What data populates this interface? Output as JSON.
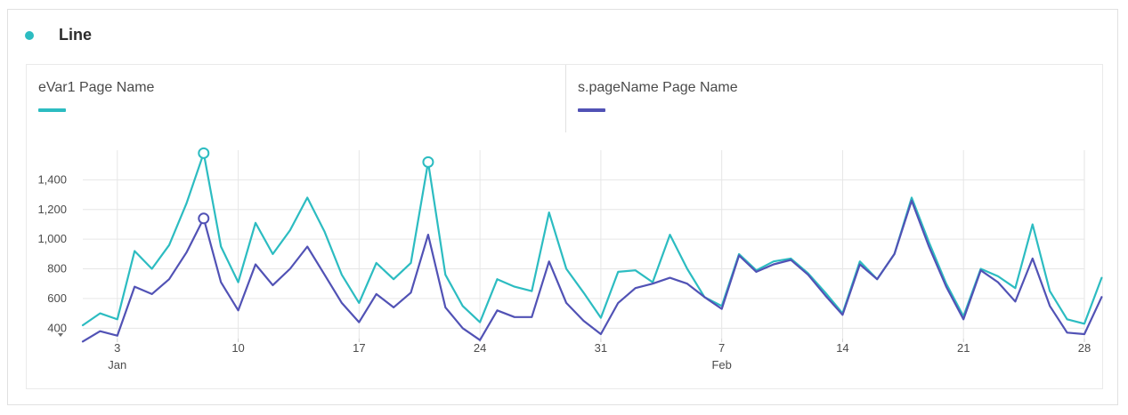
{
  "header": {
    "title": "Line",
    "dot_color": "#2cbcc1"
  },
  "legend": [
    {
      "label": "eVar1 Page Name",
      "color": "#2cbcc1"
    },
    {
      "label": "s.pageName Page Name",
      "color": "#5152b5"
    }
  ],
  "chart_data": {
    "type": "line",
    "title": "",
    "xlabel": "",
    "ylabel": "",
    "x_range": [
      "2019-01-01",
      "2019-02-28"
    ],
    "ylim": [
      330,
      1600
    ],
    "y_ticks": [
      400,
      600,
      800,
      1000,
      1200,
      1400
    ],
    "y_tick_labels": [
      "400",
      "600",
      "800",
      "1,000",
      "1,200",
      "1,400"
    ],
    "x_ticks": [
      {
        "date": "2019-01-03",
        "label": "3",
        "sublabel": "Jan"
      },
      {
        "date": "2019-01-10",
        "label": "10",
        "sublabel": ""
      },
      {
        "date": "2019-01-17",
        "label": "17",
        "sublabel": ""
      },
      {
        "date": "2019-01-24",
        "label": "24",
        "sublabel": ""
      },
      {
        "date": "2019-01-31",
        "label": "31",
        "sublabel": ""
      },
      {
        "date": "2019-02-07",
        "label": "7",
        "sublabel": "Feb"
      },
      {
        "date": "2019-02-14",
        "label": "14",
        "sublabel": ""
      },
      {
        "date": "2019-02-21",
        "label": "21",
        "sublabel": ""
      },
      {
        "date": "2019-02-28",
        "label": "28",
        "sublabel": ""
      }
    ],
    "grid": true,
    "series": [
      {
        "name": "eVar1 Page Name",
        "color": "#2cbcc1",
        "values": [
          420,
          500,
          460,
          920,
          800,
          960,
          1240,
          1580,
          950,
          710,
          1110,
          900,
          1060,
          1280,
          1050,
          760,
          570,
          840,
          730,
          840,
          1520,
          760,
          550,
          440,
          730,
          680,
          650,
          1180,
          800,
          640,
          470,
          780,
          790,
          710,
          1030,
          800,
          610,
          550,
          900,
          790,
          850,
          870,
          770,
          640,
          500,
          850,
          730,
          900,
          1280,
          980,
          700,
          480,
          800,
          750,
          670,
          1100,
          650,
          460,
          430,
          740
        ],
        "highlighted_points": [
          "2019-01-08",
          "2019-01-21"
        ]
      },
      {
        "name": "s.pageName Page Name",
        "color": "#5152b5",
        "values": [
          310,
          380,
          350,
          680,
          630,
          730,
          910,
          1140,
          710,
          520,
          830,
          690,
          800,
          950,
          760,
          570,
          440,
          630,
          540,
          640,
          1030,
          540,
          400,
          320,
          520,
          475,
          475,
          850,
          570,
          450,
          360,
          570,
          670,
          700,
          740,
          700,
          610,
          530,
          890,
          780,
          830,
          860,
          760,
          620,
          490,
          830,
          730,
          900,
          1260,
          950,
          680,
          460,
          790,
          710,
          580,
          870,
          550,
          370,
          360,
          610
        ],
        "highlighted_points": [
          "2019-01-08"
        ]
      }
    ]
  }
}
